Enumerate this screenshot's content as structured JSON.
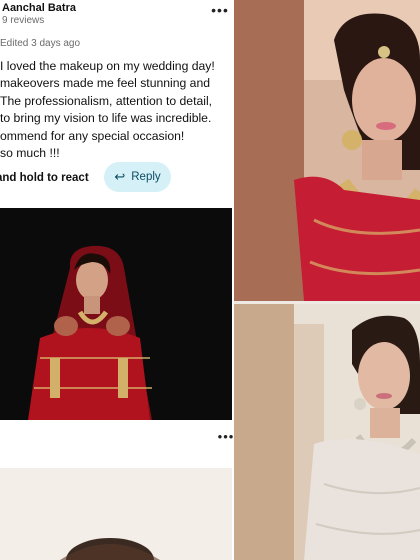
{
  "review": {
    "reviewer_name": "Aanchal Batra",
    "reviewer_meta": "9 reviews",
    "edited": "Edited 3 days ago",
    "lines": [
      "I loved the makeup on my wedding day!",
      "makeovers made me feel stunning and",
      "The professionalism, attention to detail,",
      "to bring my vision to life was incredible.",
      "ommend for any special occasion!",
      "so much !!!"
    ],
    "hold_hint": "and hold to react",
    "reply_label": "Reply"
  },
  "icons": {
    "more": "more-horizontal-icon",
    "reply": "reply-arrow-icon"
  },
  "colors": {
    "reply_bg": "#d5f1f7",
    "reply_text": "#0d4b63",
    "meta_text": "#6b6b6b"
  }
}
